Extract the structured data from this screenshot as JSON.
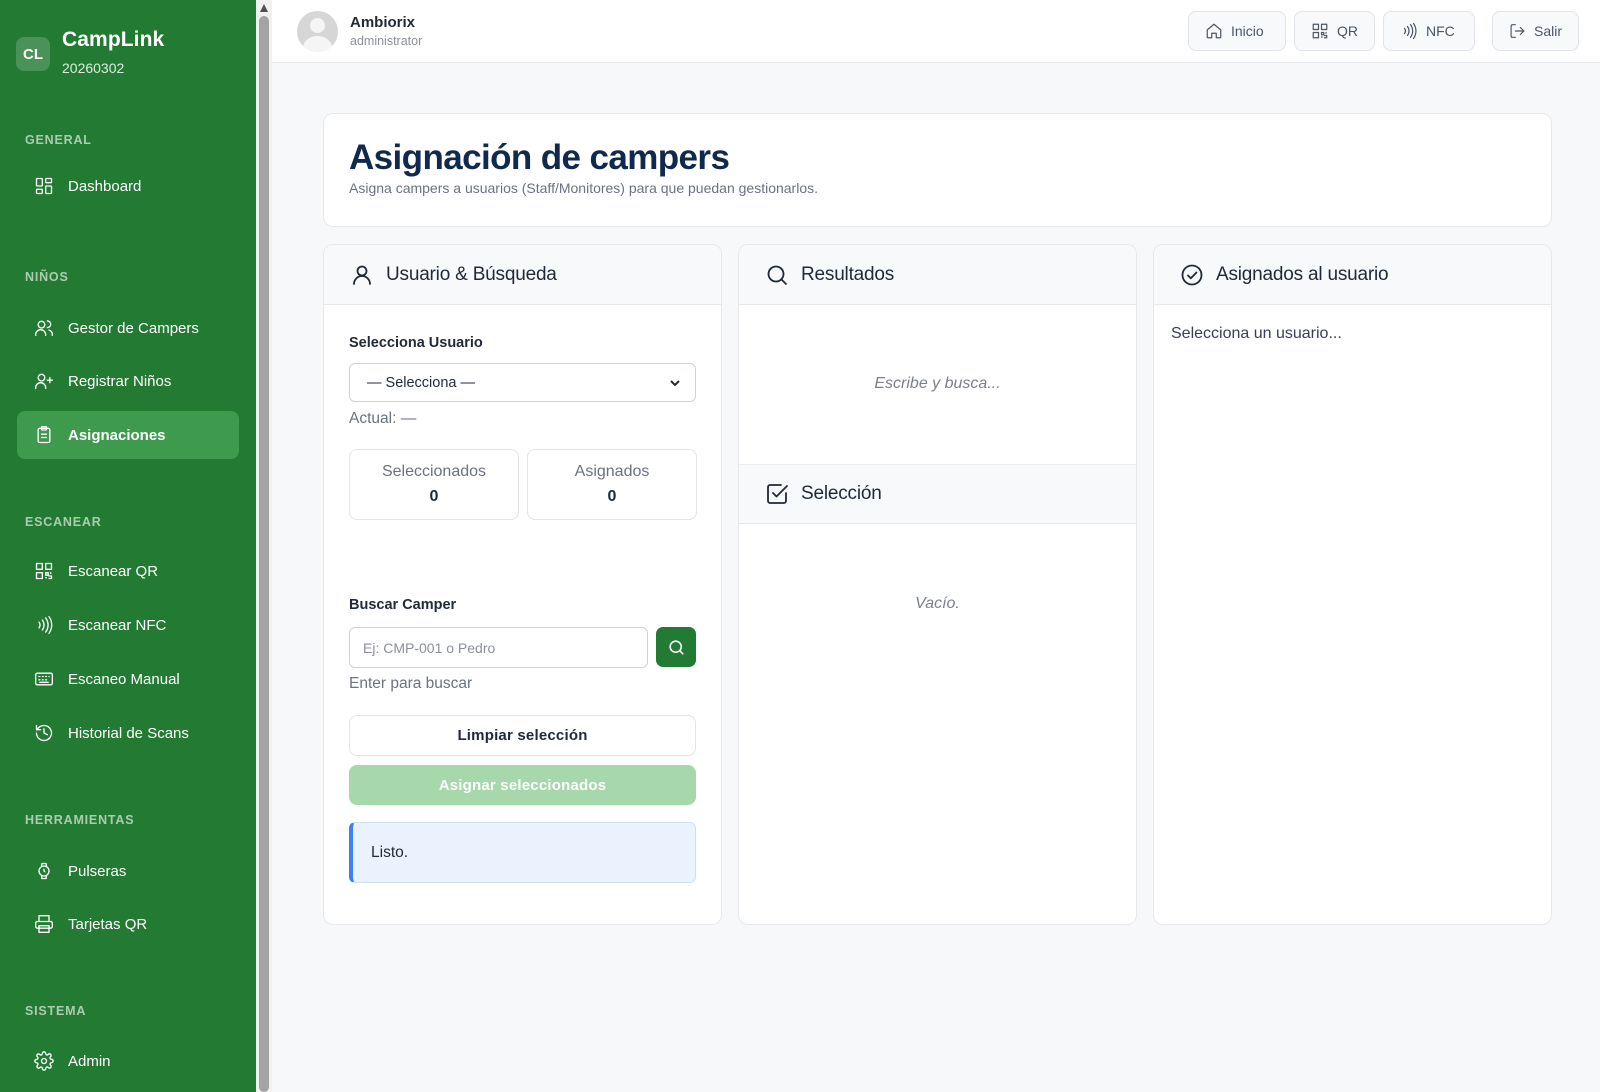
{
  "brand": {
    "badge": "CL",
    "name": "CampLink",
    "subtitle": "20260302"
  },
  "nav": {
    "sections": [
      "GENERAL",
      "NIÑOS",
      "ESCANEAR",
      "HERRAMIENTAS",
      "SISTEMA"
    ],
    "items": [
      {
        "label": "Dashboard",
        "icon": "dashboard-icon"
      },
      {
        "label": "Gestor de Campers",
        "icon": "users-icon"
      },
      {
        "label": "Registrar Niños",
        "icon": "user-plus-icon"
      },
      {
        "label": "Asignaciones",
        "icon": "clipboard-icon",
        "active": true
      },
      {
        "label": "Escanear QR",
        "icon": "qr-icon"
      },
      {
        "label": "Escanear NFC",
        "icon": "nfc-icon"
      },
      {
        "label": "Escaneo Manual",
        "icon": "keyboard-icon"
      },
      {
        "label": "Historial de Scans",
        "icon": "history-icon"
      },
      {
        "label": "Pulseras",
        "icon": "watch-icon"
      },
      {
        "label": "Tarjetas QR",
        "icon": "printer-icon"
      },
      {
        "label": "Admin",
        "icon": "gear-icon"
      }
    ]
  },
  "user": {
    "name": "Ambiorix",
    "role": "administrator"
  },
  "topbar": {
    "buttons": [
      {
        "label": "Inicio",
        "icon": "home-icon"
      },
      {
        "label": "QR",
        "icon": "qr-icon"
      },
      {
        "label": "NFC",
        "icon": "nfc-icon"
      },
      {
        "label": "Salir",
        "icon": "logout-icon"
      }
    ]
  },
  "page": {
    "title": "Asignación de campers",
    "subtitle": "Asigna campers a usuarios (Staff/Monitores) para que puedan gestionarlos."
  },
  "panel_user": {
    "title": "Usuario & Búsqueda",
    "select_label": "Selecciona Usuario",
    "select_value": "— Selecciona —",
    "current_text": "Actual: —",
    "stats": [
      {
        "label": "Seleccionados",
        "value": "0"
      },
      {
        "label": "Asignados",
        "value": "0"
      }
    ],
    "search_label": "Buscar Camper",
    "search_placeholder": "Ej: CMP-001 o Pedro",
    "search_hint": "Enter para buscar",
    "clear_button": "Limpiar selección",
    "assign_button": "Asignar seleccionados",
    "status_message": "Listo."
  },
  "panel_results": {
    "title": "Resultados",
    "empty_text": "Escribe y busca...",
    "selection_title": "Selección",
    "selection_empty": "Vacío."
  },
  "panel_assigned": {
    "title": "Asignados al usuario",
    "empty_text": "Selecciona un usuario..."
  },
  "colors": {
    "sidebar": "#237a33",
    "active_item": "#3e9a4c",
    "title": "#0f2a4d",
    "assign_disabled": "#a6d8ab",
    "info": "#3b82f6"
  }
}
